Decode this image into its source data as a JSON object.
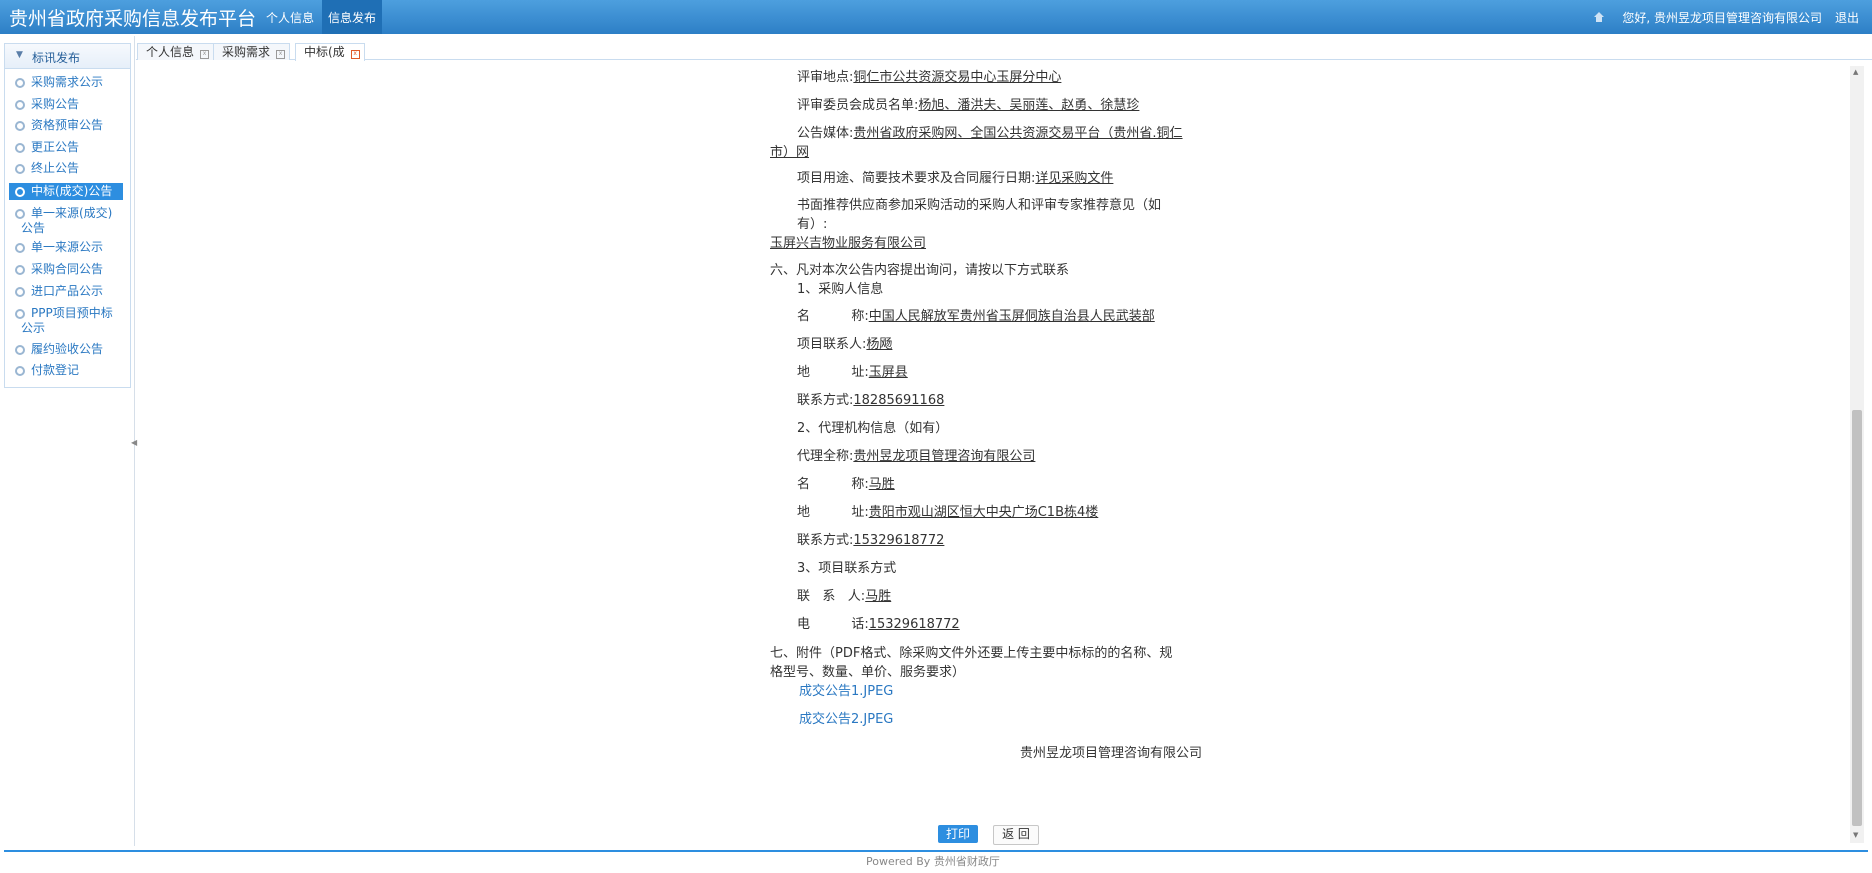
{
  "header": {
    "app_title": "贵州省政府采购信息发布平台",
    "nav_tabs": [
      "个人信息",
      "信息发布"
    ],
    "greeting": "您好, 贵州昱龙项目管理咨询有限公司",
    "logout": "退出",
    "home_icon": "home-icon"
  },
  "sidebar": {
    "title": "标讯发布",
    "items": [
      "采购需求公示",
      "采购公告",
      "资格预审公告",
      "更正公告",
      "终止公告",
      "中标(成交)公告",
      "单一来源(成交)公告",
      "单一来源公示",
      "采购合同公告",
      "进口产品公示",
      "PPP项目预中标公示",
      "履约验收公告",
      "付款登记"
    ],
    "active_item": "中标(成交)公告"
  },
  "tabs": [
    {
      "label": "个人信息"
    },
    {
      "label": "采购需求"
    },
    {
      "label": "中标(成"
    }
  ],
  "document": {
    "review_location_label": "评审地点:",
    "review_location": "铜仁市公共资源交易中心玉屏分中心",
    "committee_label": "评审委员会成员名单:",
    "committee": "杨旭、潘洪夫、吴丽莲、赵勇、徐慧珍",
    "media_label": "公告媒体:",
    "media_line1": "贵州省政府采购网、全国公共资源交易平台（贵州省.铜仁",
    "media_line2": "市）网",
    "purpose_label": "项目用途、简要技术要求及合同履行日期:",
    "purpose": "详见采购文件",
    "recommend_line1": "书面推荐供应商参加采购活动的采购人和评审专家推荐意见（如",
    "recommend_line2": "有）:",
    "recommend_value": "玉屏兴吉物业服务有限公司",
    "section6": "六、凡对本次公告内容提出询问，请按以下方式联系",
    "purchaser_heading": "1、采购人信息",
    "purchaser_name_label": "名          称:",
    "purchaser_name": "中国人民解放军贵州省玉屏侗族自治县人民武装部",
    "purchaser_contact_label": "项目联系人:",
    "purchaser_contact": "杨飏",
    "purchaser_address_label": "地          址:",
    "purchaser_address": "玉屏县",
    "purchaser_phone_label": "联系方式:",
    "purchaser_phone": "18285691168",
    "agency_heading": "2、代理机构信息（如有）",
    "agency_fullname_label": "代理全称:",
    "agency_fullname": "贵州昱龙项目管理咨询有限公司",
    "agency_name_label": "名          称:",
    "agency_name": "马胜",
    "agency_address_label": "地          址:",
    "agency_address": "贵阳市观山湖区恒大中央广场C1B栋4楼",
    "agency_phone_label": "联系方式:",
    "agency_phone": "15329618772",
    "project_contact_heading": "3、项目联系方式",
    "project_contact_label": "联   系   人:",
    "project_contact": "马胜",
    "project_phone_label": "电          话:",
    "project_phone": "15329618772",
    "section7_line1": "七、附件（PDF格式、除采购文件外还要上传主要中标标的的名称、规",
    "section7_line2": "格型号、数量、单价、服务要求）",
    "attachments": [
      "成交公告1.JPEG",
      "成交公告2.JPEG"
    ],
    "signature": "贵州昱龙项目管理咨询有限公司"
  },
  "buttons": {
    "print": "打印",
    "back": "返 回"
  },
  "footer": "Powered By 贵州省财政厅"
}
